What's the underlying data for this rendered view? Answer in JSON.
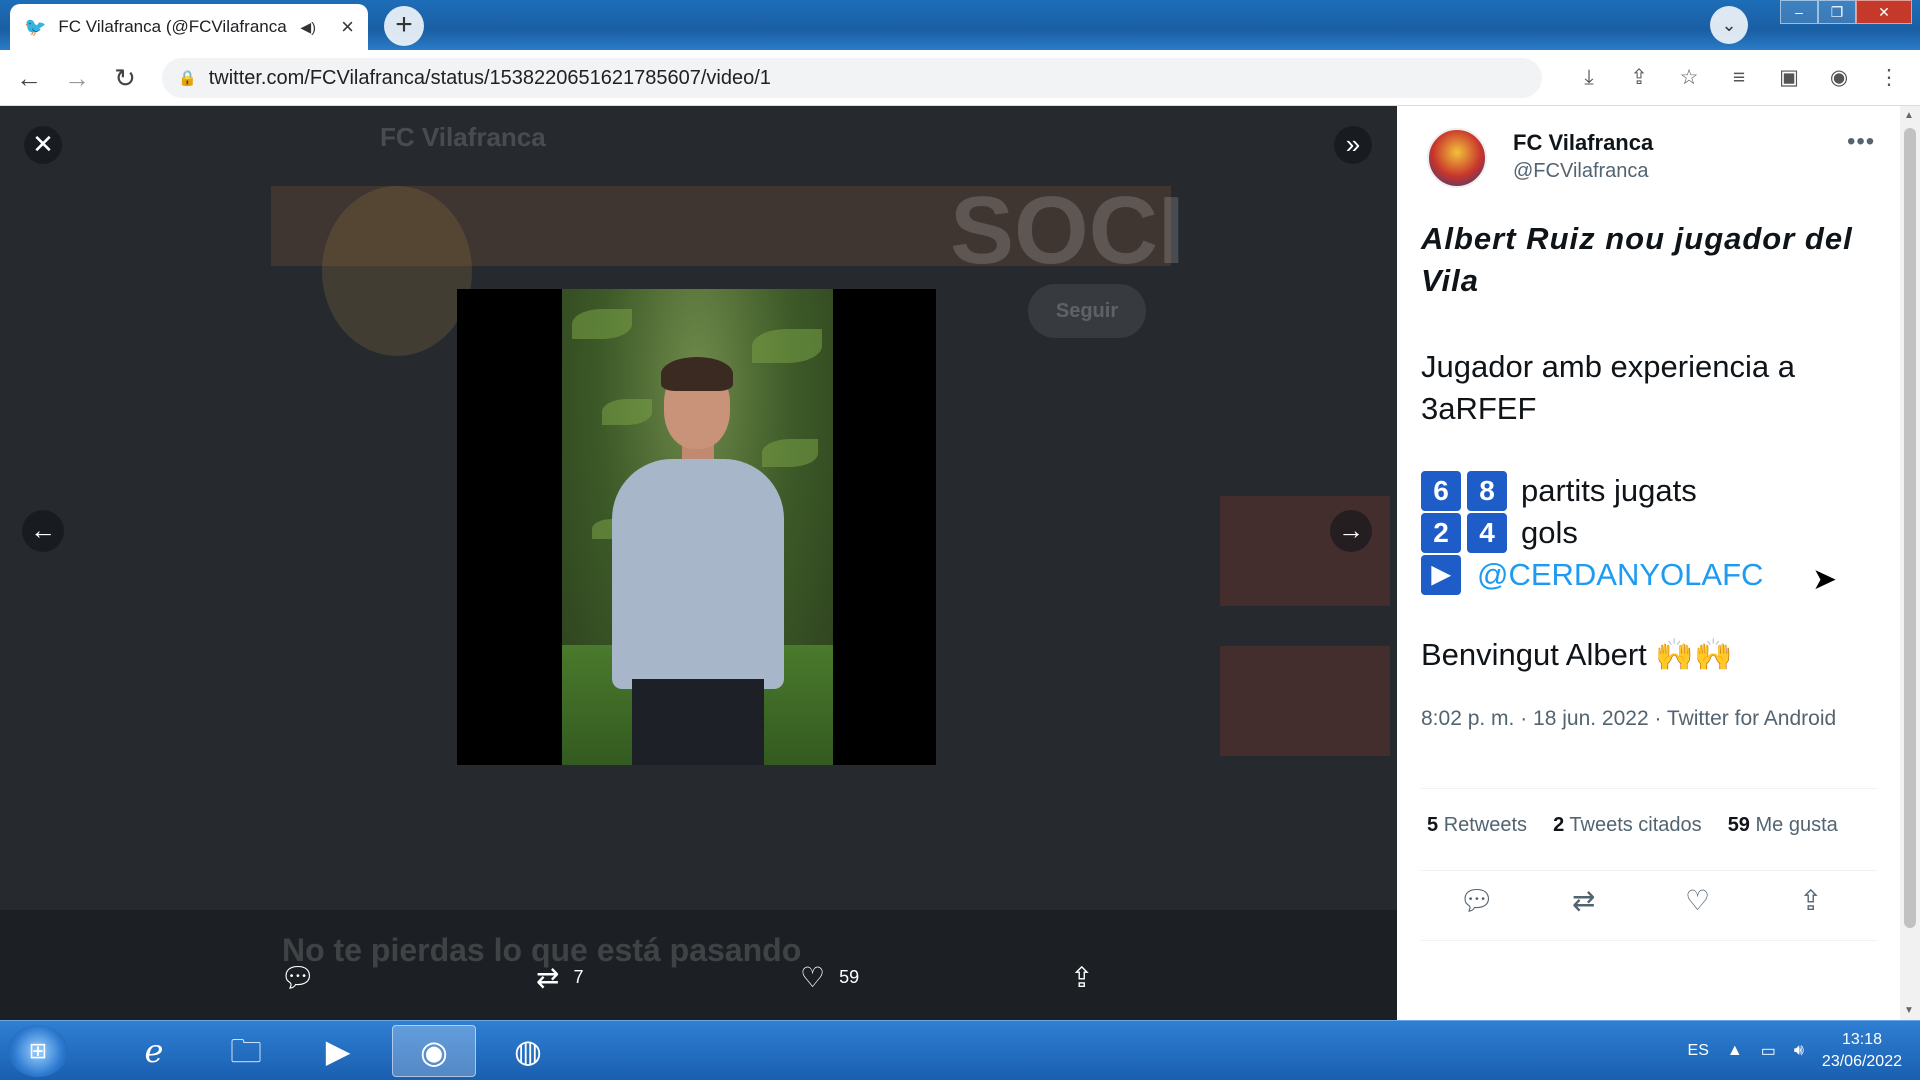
{
  "browser": {
    "tab_title": "FC Vilafranca (@FCVilafranca",
    "url": "twitter.com/FCVilafranca/status/1538220651621785607/video/1",
    "newtab_icon": "+",
    "close_tab_icon": "×"
  },
  "background": {
    "header_name": "FC Vilafranca",
    "banner_text": "SOCI",
    "follow_label": "Seguir",
    "bottom_banner": "No te pierdas lo que está pasando"
  },
  "viewer": {
    "retweets": "7",
    "likes": "59"
  },
  "tweet": {
    "name": "FC Vilafranca",
    "handle": "@FCVilafranca",
    "title": "Albert Ruiz nou jugador del Vila",
    "paragraph1": "Jugador amb experiencia a 3aRFEF",
    "stat1_digits": [
      "6",
      "8"
    ],
    "stat1_label": "partits jugats",
    "stat2_digits": [
      "2",
      "4"
    ],
    "stat2_label": "gols",
    "play_icon": "▶",
    "mention": "@CERDANYOLAFC",
    "paragraph3": "Benvingut Albert",
    "paragraph3_emoji": "🙌🙌",
    "meta": "8:02 p. m. · 18 jun. 2022 · Twitter for Android",
    "retweets_count": "5",
    "retweets_label": "Retweets",
    "quotes_count": "2",
    "quotes_label": "Tweets citados",
    "likes_count": "59",
    "likes_label": "Me gusta"
  },
  "taskbar": {
    "lang": "ES",
    "time": "13:18",
    "date": "23/06/2022"
  },
  "colors": {
    "accent": "#1d9bf0",
    "keycap": "#1e5dc7",
    "viewer_bg": "#262a2f"
  }
}
